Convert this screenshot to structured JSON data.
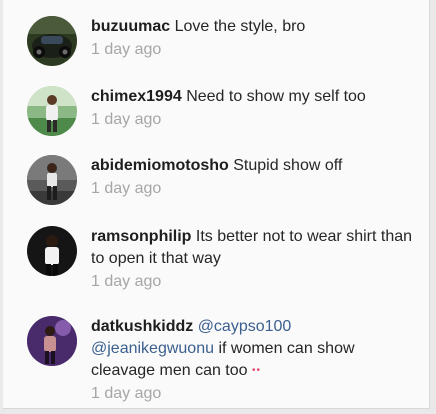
{
  "comments": [
    {
      "username": "buzuumac",
      "text": "Love the style, bro",
      "time": "1 day ago",
      "avatar_icon": "user-avatar-dark-car",
      "avatar_color": "#243018"
    },
    {
      "username": "chimex1994",
      "text": "Need to show my self too",
      "time": "1 day ago",
      "avatar_icon": "user-avatar-person-outdoor",
      "avatar_color": "#6fa26c"
    },
    {
      "username": "abidemiomotosho",
      "text": "Stupid show off",
      "time": "1 day ago",
      "avatar_icon": "user-avatar-person-standing",
      "avatar_color": "#3e3e3e"
    },
    {
      "username": "ramsonphilip",
      "text": "Its better not to wear shirt than to open it that way",
      "time": "1 day ago",
      "avatar_icon": "user-avatar-person-dark",
      "avatar_color": "#141414"
    },
    {
      "username": "datkushkiddz",
      "mention1": "@caypso100",
      "mention2": "@jeanikegwuonu",
      "text": "if women can show cleavage men can too",
      "emoji": "••",
      "time": "1 day ago",
      "avatar_icon": "user-avatar-person-purple",
      "avatar_color": "#4b2a6e"
    }
  ],
  "colors": {
    "username": "#1e1e1e",
    "mention": "#3b5f8e",
    "timestamp": "#a6a6a6",
    "background": "#fafafa"
  }
}
